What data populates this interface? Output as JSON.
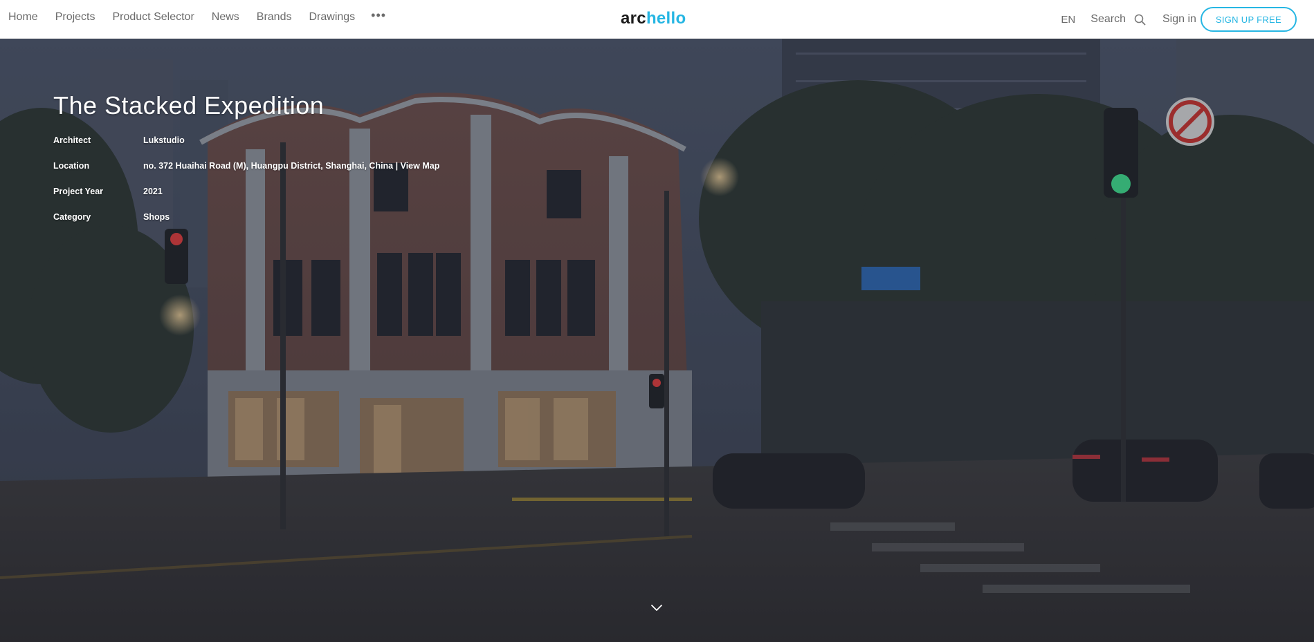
{
  "nav": {
    "items": [
      {
        "label": "Home"
      },
      {
        "label": "Projects"
      },
      {
        "label": "Product Selector"
      },
      {
        "label": "News"
      },
      {
        "label": "Brands"
      },
      {
        "label": "Drawings"
      }
    ],
    "more_label": "•••",
    "logo": {
      "part1": "arc",
      "part2": "h",
      "part3": "ello"
    },
    "language": "EN",
    "search_label": "Search",
    "signin_label": "Sign in",
    "signup_label": "SIGN UP FREE"
  },
  "project": {
    "title": "The Stacked Expedition",
    "meta": [
      {
        "label": "Architect",
        "value": "Lukstudio"
      },
      {
        "label": "Location",
        "value": "no. 372 Huaihai Road (M), Huangpu District, Shanghai, China |",
        "link": "View Map"
      },
      {
        "label": "Project Year",
        "value": "2021"
      },
      {
        "label": "Category",
        "value": "Shops"
      }
    ]
  },
  "colors": {
    "accent": "#26b6e3",
    "nav_text": "#6b6b6b",
    "logo_dark": "#1b1b1b"
  },
  "icons": {
    "search": "magnifier-icon",
    "scroll": "chevron-down-icon"
  }
}
